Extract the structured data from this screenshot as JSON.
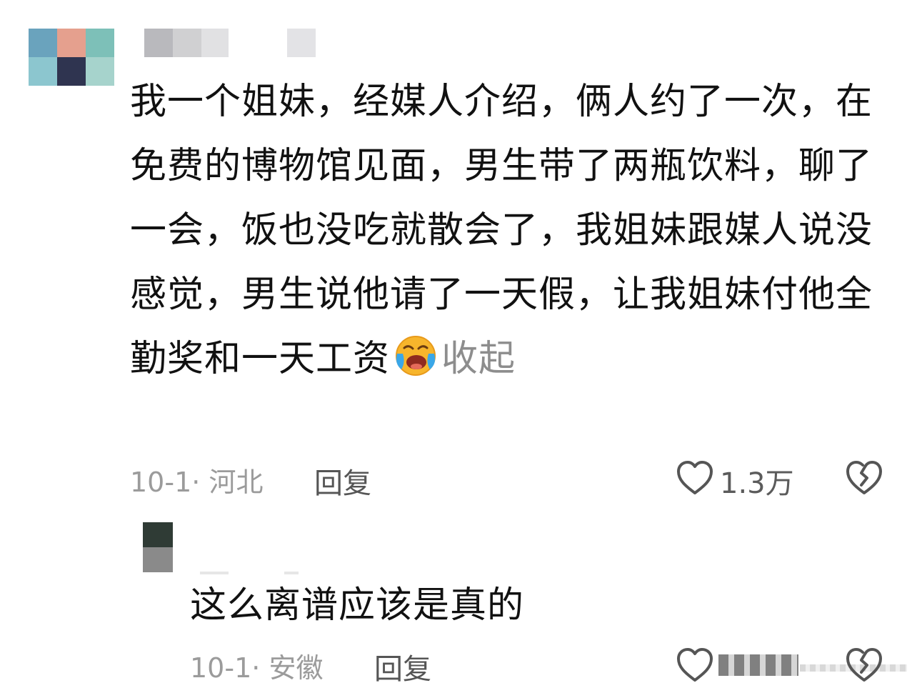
{
  "comment": {
    "avatar_colors": [
      "#6aa3bd",
      "#e5a08e",
      "#7dc0b8",
      "#8cc6cf",
      "#2f3450",
      "#a6d3cc"
    ],
    "text": "我一个姐妹，经媒人介绍，俩人约了一次，在免费的博物馆见面，男生带了两瓶饮料，聊了一会，饭也没吃就散会了，我姐妹跟媒人说没感觉，男生说他请了一天假，让我姐妹付他全勤奖和一天工资",
    "emoji": "face-with-tears-of-joy-icon",
    "collapse_label": "收起",
    "date": "10-1",
    "location": "河北",
    "separator": "·",
    "reply_label": "回复",
    "like_count": "1.3万"
  },
  "reply": {
    "avatar_colors": [
      "#2f3b35",
      "#8a8a8a"
    ],
    "text": "这么离谱应该是真的",
    "date": "10-1",
    "location": "安徽",
    "separator": "·",
    "reply_label": "回复"
  },
  "icons": {
    "like": "heart-icon",
    "dislike": "broken-heart-icon"
  }
}
